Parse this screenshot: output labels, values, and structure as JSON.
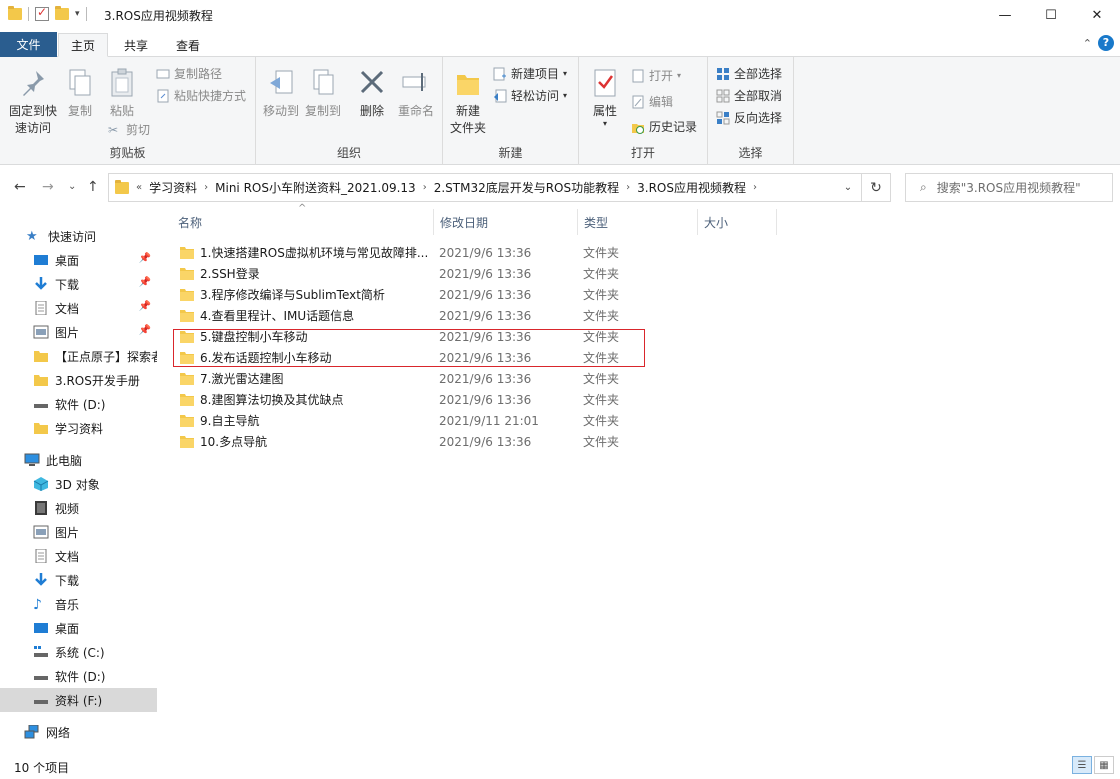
{
  "window": {
    "title": "3.ROS应用视频教程"
  },
  "tabs": {
    "file": "文件",
    "home": "主页",
    "share": "共享",
    "view": "查看"
  },
  "ribbon": {
    "clipboard": {
      "label": "剪贴板",
      "pin": "固定到快\n速访问",
      "pin1": "固定到快",
      "pin2": "速访问",
      "copy": "复制",
      "paste": "粘贴",
      "copy_path": "复制路径",
      "paste_shortcut": "粘贴快捷方式",
      "cut": "剪切"
    },
    "organize": {
      "label": "组织",
      "move_to": "移动到",
      "copy_to": "复制到",
      "delete": "删除",
      "rename": "重命名"
    },
    "new": {
      "label": "新建",
      "new_folder1": "新建",
      "new_folder2": "文件夹",
      "new_item": "新建项目",
      "easy_access": "轻松访问"
    },
    "open": {
      "label": "打开",
      "properties": "属性",
      "open": "打开",
      "edit": "编辑",
      "history": "历史记录"
    },
    "select": {
      "label": "选择",
      "select_all": "全部选择",
      "select_none": "全部取消",
      "invert": "反向选择"
    }
  },
  "address": {
    "crumbs": [
      "学习资料",
      "Mini ROS小车附送资料_2021.09.13",
      "2.STM32底层开发与ROS功能教程",
      "3.ROS应用视频教程"
    ],
    "search_placeholder": "搜索\"3.ROS应用视频教程\""
  },
  "sidebar": {
    "quick_access": "快速访问",
    "quick_items": [
      "桌面",
      "下载",
      "文档",
      "图片",
      "【正点原子】探索者",
      "3.ROS开发手册",
      "软件 (D:)",
      "学习资料"
    ],
    "this_pc": "此电脑",
    "pc_items": [
      "3D 对象",
      "视频",
      "图片",
      "文档",
      "下载",
      "音乐",
      "桌面",
      "系统 (C:)",
      "软件 (D:)",
      "资料 (F:)"
    ],
    "network": "网络"
  },
  "columns": {
    "name": "名称",
    "date": "修改日期",
    "type": "类型",
    "size": "大小"
  },
  "files": [
    {
      "name": "1.快速搭建ROS虚拟机环境与常见故障排...",
      "date": "2021/9/6 13:36",
      "type": "文件夹"
    },
    {
      "name": "2.SSH登录",
      "date": "2021/9/6 13:36",
      "type": "文件夹"
    },
    {
      "name": "3.程序修改编译与SublimText简析",
      "date": "2021/9/6 13:36",
      "type": "文件夹"
    },
    {
      "name": "4.查看里程计、IMU话题信息",
      "date": "2021/9/6 13:36",
      "type": "文件夹"
    },
    {
      "name": "5.键盘控制小车移动",
      "date": "2021/9/6 13:36",
      "type": "文件夹"
    },
    {
      "name": "6.发布话题控制小车移动",
      "date": "2021/9/6 13:36",
      "type": "文件夹"
    },
    {
      "name": "7.激光雷达建图",
      "date": "2021/9/6 13:36",
      "type": "文件夹"
    },
    {
      "name": "8.建图算法切换及其优缺点",
      "date": "2021/9/6 13:36",
      "type": "文件夹"
    },
    {
      "name": "9.自主导航",
      "date": "2021/9/11 21:01",
      "type": "文件夹"
    },
    {
      "name": "10.多点导航",
      "date": "2021/9/6 13:36",
      "type": "文件夹"
    }
  ],
  "status": {
    "count": "10 个项目"
  },
  "colors": {
    "accent": "#1979ca",
    "folder": "#f3c84a",
    "highlight": "#d9262c"
  }
}
